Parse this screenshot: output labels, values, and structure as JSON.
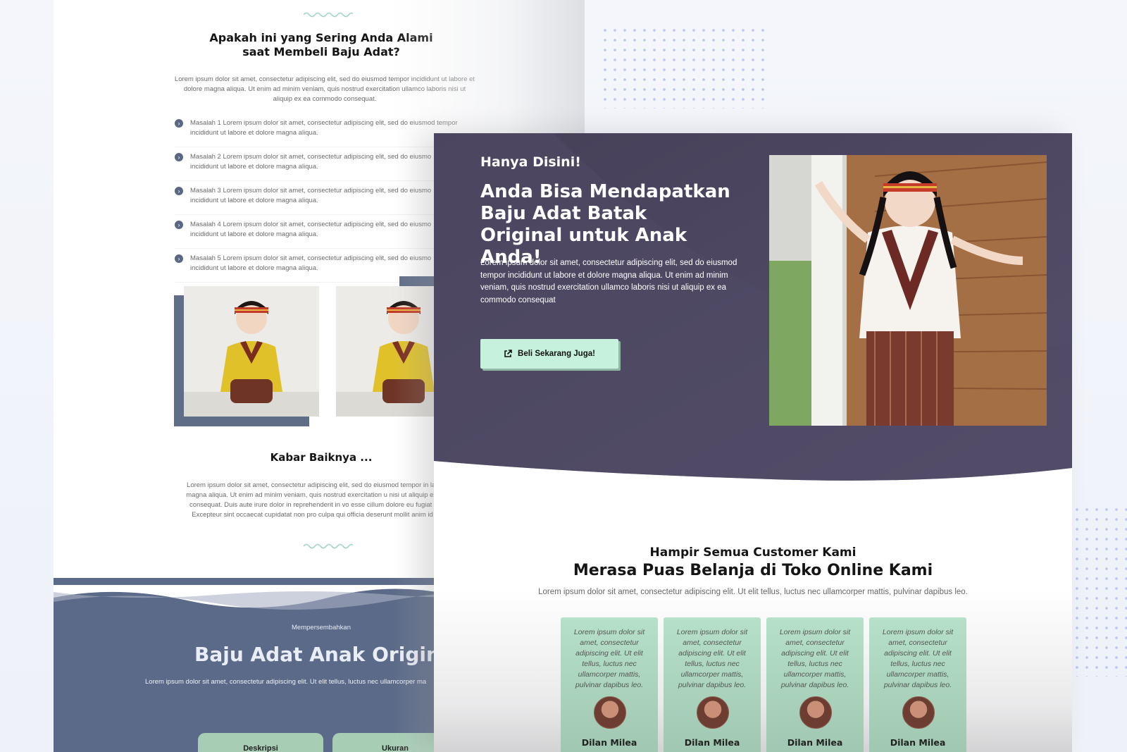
{
  "back_page": {
    "problem_title_line1": "Apakah ini yang Sering Anda Alami",
    "problem_title_line2": "saat Membeli Baju Adat?",
    "problem_body": "Lorem ipsum dolor sit amet, consectetur adipiscing elit, sed do eiusmod tempor incididunt ut labore et dolore magna aliqua. Ut enim ad minim veniam, quis nostrud exercitation ullamco laboris nisi ut aliquip ex ea commodo consequat.",
    "problems": [
      {
        "line1": "Masalah 1 Lorem ipsum dolor sit amet, consectetur adipiscing elit, sed do eiusmod tempor",
        "line2": "incididunt ut labore et dolore magna aliqua."
      },
      {
        "line1": "Masalah 2 Lorem ipsum dolor sit amet, consectetur adipiscing elit, sed do eiusmo",
        "line2": "incididunt ut labore et dolore magna aliqua."
      },
      {
        "line1": "Masalah 3 Lorem ipsum dolor sit amet, consectetur adipiscing elit, sed do eiusmo",
        "line2": "incididunt ut labore et dolore magna aliqua."
      },
      {
        "line1": "Masalah 4 Lorem ipsum dolor sit amet, consectetur adipiscing elit, sed do eiusmo",
        "line2": "incididunt ut labore et dolore magna aliqua."
      },
      {
        "line1": "Masalah 5 Lorem ipsum dolor sit amet, consectetur adipiscing elit, sed do eiusmo",
        "line2": "incididunt ut labore et dolore magna aliqua."
      }
    ],
    "kabar_title": "Kabar Baiknya ...",
    "kabar_body": "Lorem ipsum dolor sit amet, consectetur adipiscing elit, sed do eiusmod tempor in labore et dolore magna aliqua. Ut enim ad minim veniam, quis nostrud exercitation u nisi ut aliquip ex ea commodo consequat. Duis aute irure dolor in reprehenderit in vo esse cillum dolore eu fugiat nulla pariatur. Excepteur sint occaecat cupidatat non pro culpa qui officia deserunt mollit anim id est laborum.",
    "presenting": "Mempersembahkan",
    "product_title": "Baju Adat Anak Origin",
    "product_sub": "Lorem ipsum dolor sit amet, consectetur adipiscing elit. Ut elit tellus, luctus nec ullamcorper ma",
    "tabs": [
      "Deskripsi",
      "Ukuran"
    ]
  },
  "hero": {
    "kicker": "Hanya Disini!",
    "title": "Anda Bisa Mendapatkan Baju Adat Batak Original untuk Anak Anda!",
    "body": "Lorem ipsum dolor sit amet, consectetur adipiscing elit, sed do eiusmod tempor incididunt ut labore et dolore magna aliqua. Ut enim ad minim veniam, quis nostrud exercitation ullamco laboris nisi ut aliquip ex ea commodo consequat",
    "cta_label": "Beli Sekarang Juga!",
    "cta_icon": "external-link-icon"
  },
  "testimonials": {
    "subtitle": "Hampir Semua Customer Kami",
    "title": "Merasa Puas Belanja di Toko Online Kami",
    "body": "Lorem ipsum dolor sit amet, consectetur adipiscing elit. Ut elit tellus, luctus nec ullamcorper mattis, pulvinar dapibus leo.",
    "cards": [
      {
        "text": "Lorem ipsum dolor sit amet, consectetur adipiscing elit. Ut elit tellus, luctus nec ullamcorper mattis, pulvinar dapibus leo.",
        "name": "Dilan Milea"
      },
      {
        "text": "Lorem ipsum dolor sit amet, consectetur adipiscing elit. Ut elit tellus, luctus nec ullamcorper mattis, pulvinar dapibus leo.",
        "name": "Dilan Milea"
      },
      {
        "text": "Lorem ipsum dolor sit amet, consectetur adipiscing elit. Ut elit tellus, luctus nec ullamcorper mattis, pulvinar dapibus leo.",
        "name": "Dilan Milea"
      },
      {
        "text": "Lorem ipsum dolor sit amet, consectetur adipiscing elit. Ut elit tellus, luctus nec ullamcorper mattis, pulvinar dapibus leo.",
        "name": "Dilan Milea"
      }
    ]
  },
  "colors": {
    "hero_bg": "#4b4560",
    "cta_bg": "#c6f1dc",
    "card_bg": "#b6e0c9",
    "band_bg": "#5b6a88",
    "accent_dots": "#b9c4f0"
  }
}
